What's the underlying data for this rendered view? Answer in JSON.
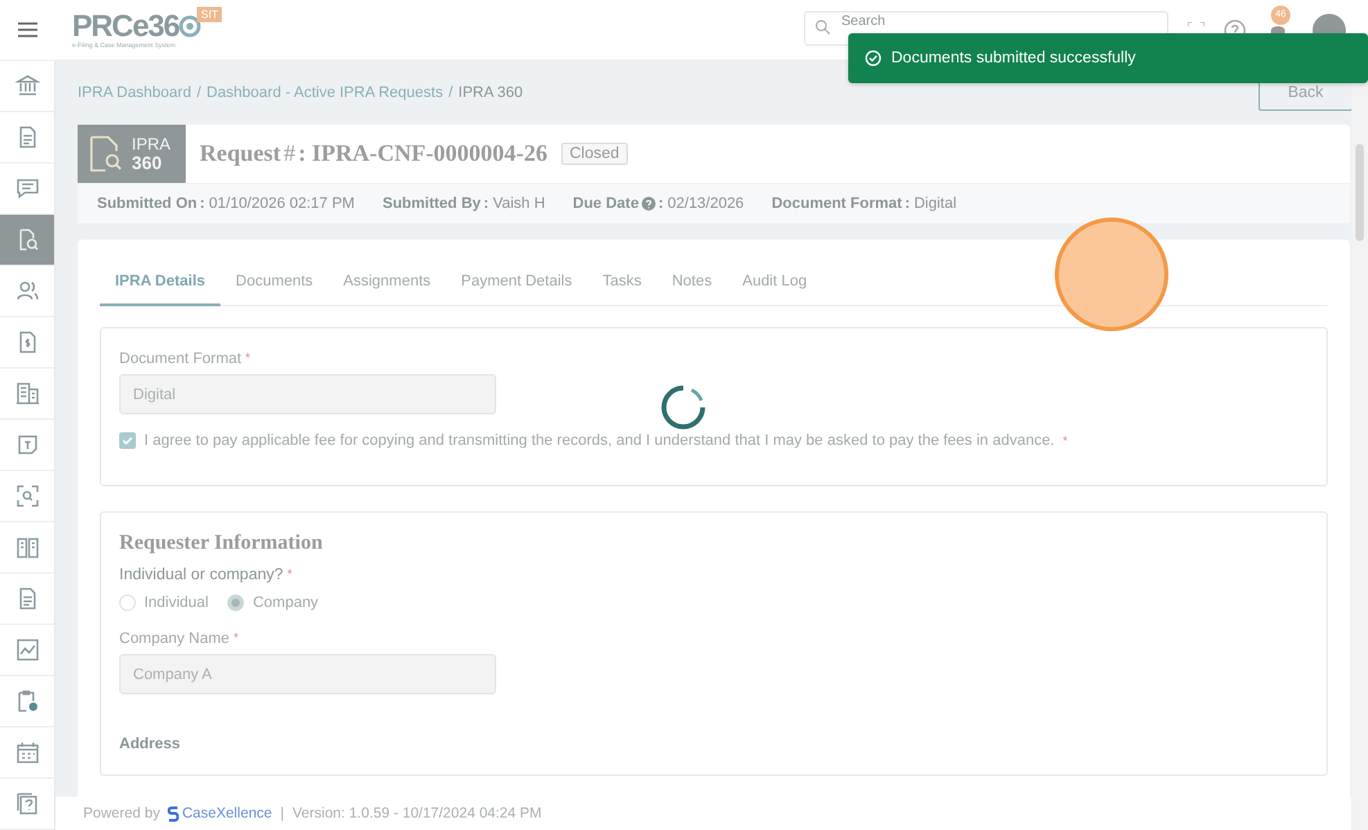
{
  "top_bar": {
    "logo": "PRCe36",
    "logo_subtitle": "e-Filing & Case Management System",
    "environment_badge": "SIT",
    "search": {
      "placeholder": "Search"
    },
    "notification_count": "46"
  },
  "toast": {
    "message": "Documents submitted successfully"
  },
  "sidebar": {
    "items": [
      {
        "selected": false
      },
      {
        "selected": false
      },
      {
        "selected": false
      },
      {
        "selected": true
      },
      {
        "selected": false
      },
      {
        "selected": false
      },
      {
        "selected": false
      },
      {
        "selected": false
      },
      {
        "selected": false
      },
      {
        "selected": false
      },
      {
        "selected": false
      },
      {
        "selected": false
      },
      {
        "selected": false
      },
      {
        "selected": false
      },
      {
        "selected": false
      }
    ]
  },
  "breadcrumb": [
    {
      "kind": "link",
      "text": "IPRA Dashboard"
    },
    {
      "kind": "separator",
      "text": "/"
    },
    {
      "kind": "link",
      "text": "Dashboard - Active IPRA Requests"
    },
    {
      "kind": "separator",
      "text": "/"
    },
    {
      "kind": "current",
      "text": "IPRA 360"
    }
  ],
  "back_button": "Back",
  "request": {
    "badge_line_1": "IPRA",
    "badge_line_2": "360",
    "title": "Request",
    "hash_mark": "#",
    "request_number": ": IPRA-CNF-0000004-26",
    "status": "Closed",
    "meta": [
      {
        "label": "Submitted On",
        "help": false,
        "separator": ":",
        "value": "01/10/2026 02:17 PM"
      },
      {
        "label": "Submitted By",
        "help": false,
        "separator": ":",
        "value": "Vaish H"
      },
      {
        "label": "Due Date",
        "help": true,
        "separator": ":",
        "value": "02/13/2026"
      },
      {
        "label": "Document Format",
        "help": false,
        "separator": ":",
        "value": "Digital"
      }
    ]
  },
  "tabs": [
    {
      "label": "IPRA Details",
      "selected": true
    },
    {
      "label": "Documents",
      "selected": false
    },
    {
      "label": "Assignments",
      "selected": false
    },
    {
      "label": "Payment Details",
      "selected": false
    },
    {
      "label": "Tasks",
      "selected": false
    },
    {
      "label": "Notes",
      "selected": false
    },
    {
      "label": "Audit Log",
      "selected": false
    }
  ],
  "document_format": {
    "label": "Document Format",
    "required_mark": "*",
    "value": "Digital",
    "agreement": {
      "text": "I agree to pay applicable fee for copying and transmitting the records, and I understand that I may be asked to pay the fees in advance.",
      "required_mark": "*",
      "checked": true
    }
  },
  "requester_information": {
    "heading": "Requester Information",
    "question": "Individual or company?",
    "question_required_mark": "*",
    "options": [
      {
        "label": "Individual",
        "selected": false
      },
      {
        "label": "Company",
        "selected": true
      }
    ],
    "company_name": {
      "label": "Company Name",
      "required_mark": "*",
      "value": "Company A"
    },
    "address_heading": "Address"
  },
  "footer": {
    "powered_by": "Powered by",
    "brand": "CaseXellence",
    "separator": "|",
    "version": "Version: 1.0.59 - 10/17/2024 04:24 PM"
  }
}
